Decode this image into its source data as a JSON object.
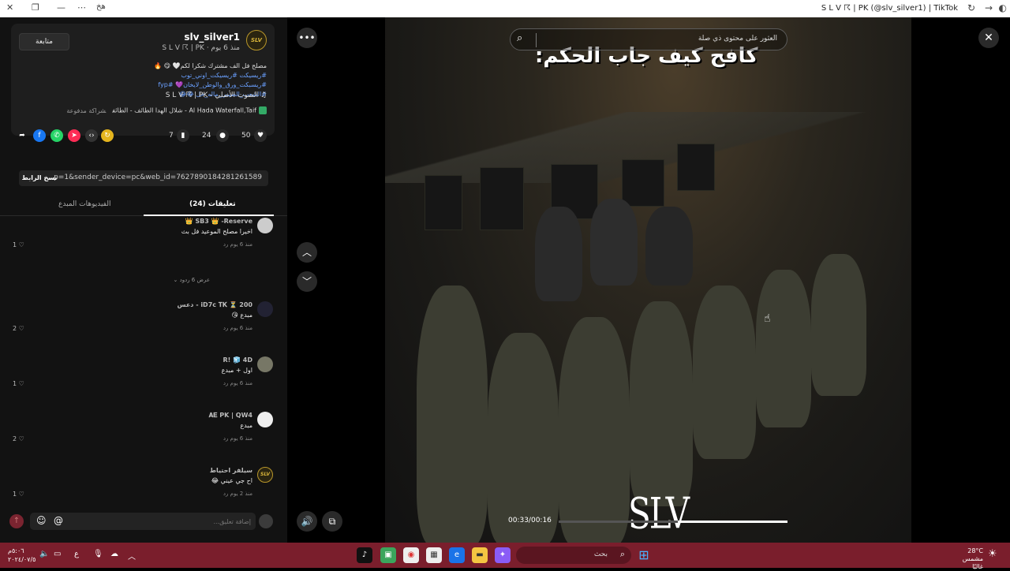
{
  "window": {
    "title": "S L V ☈ | PK (@slv_silver1) | TikTok",
    "left_label": "ھخ"
  },
  "post": {
    "author_name": "slv_silver1",
    "author_sub": "S L V ☈ | PK · منذ 6 يوم",
    "avatar_label": "SLV",
    "follow_label": "متابعة",
    "description": "مصلح فل الف مشترك شكرا لكم🤍 😋 🔥",
    "tags_line1": "#ريسيكت #ريسيكت_اوني_توب",
    "tags_line2": "#ريسبكت_ورق_والوطن_لايخان💜 #fyp",
    "tags_line3": "#الشعب_الصيني_ماله_حل 😂😂",
    "music": "♫ الصوت الأصلي - S L V ☈ | PK",
    "location": "Al Hada Waterfall,Taif - شلال الهدا الطائف - الطائف",
    "partner": "شراكة مدفوعة",
    "likes": "50",
    "comments": "24",
    "saves": "7",
    "link_url": "...p=1&sender_device=pc&web_id=7627890184281261589",
    "copy_label": "نسخ الرابط"
  },
  "tabs": {
    "comments": "تعليقات (24)",
    "creator_videos": "الفيديوهات المبدع"
  },
  "comments": [
    {
      "user": "SB3 👑 -Reserve 👑",
      "text": "اخيرا مصلح الموعيد فل بث",
      "meta": "منذ 6 يوم    رد",
      "likes": "1"
    },
    {
      "user": "200 ⏳ iD7c 𝐓𝐊 - دعس",
      "text": "مبدع 😘",
      "meta": "منذ 6 يوم    رد",
      "likes": "2"
    },
    {
      "user": "R! 🧊 4D",
      "text": "اول + مبدع",
      "meta": "منذ 6 يوم    رد",
      "likes": "1"
    },
    {
      "user": "𝐀𝐄 PK | QW4",
      "text": "مبدع",
      "meta": "منذ 6 يوم    رد",
      "likes": "2"
    },
    {
      "user": "سيلفر احتياط",
      "text": "اح جي عيني 😂",
      "meta": "منذ 2 يوم    رد",
      "likes": "1"
    }
  ],
  "replies_label": "عرض 6 ردود ⌄",
  "comment_input": {
    "placeholder": "إضافة تعليق..."
  },
  "video": {
    "search_text": "العثور على محتوى ذي صلة",
    "overlay_text": "كافح كيف جاب الحكم:",
    "time": "00:33/00:16",
    "progress": 0.48,
    "watermark": "SLV"
  },
  "taskbar": {
    "search_text": "بحث",
    "weather_temp": "28°C",
    "weather_desc": "مشمس غالبًا",
    "clock_time": "٥:٠٦م",
    "clock_date": "٢٠٢٤/٠٧/٥",
    "lang": "ع"
  },
  "colors": {
    "accent": "#fe2c55",
    "taskbar": "#7a1e2c",
    "panel": "#121212"
  }
}
